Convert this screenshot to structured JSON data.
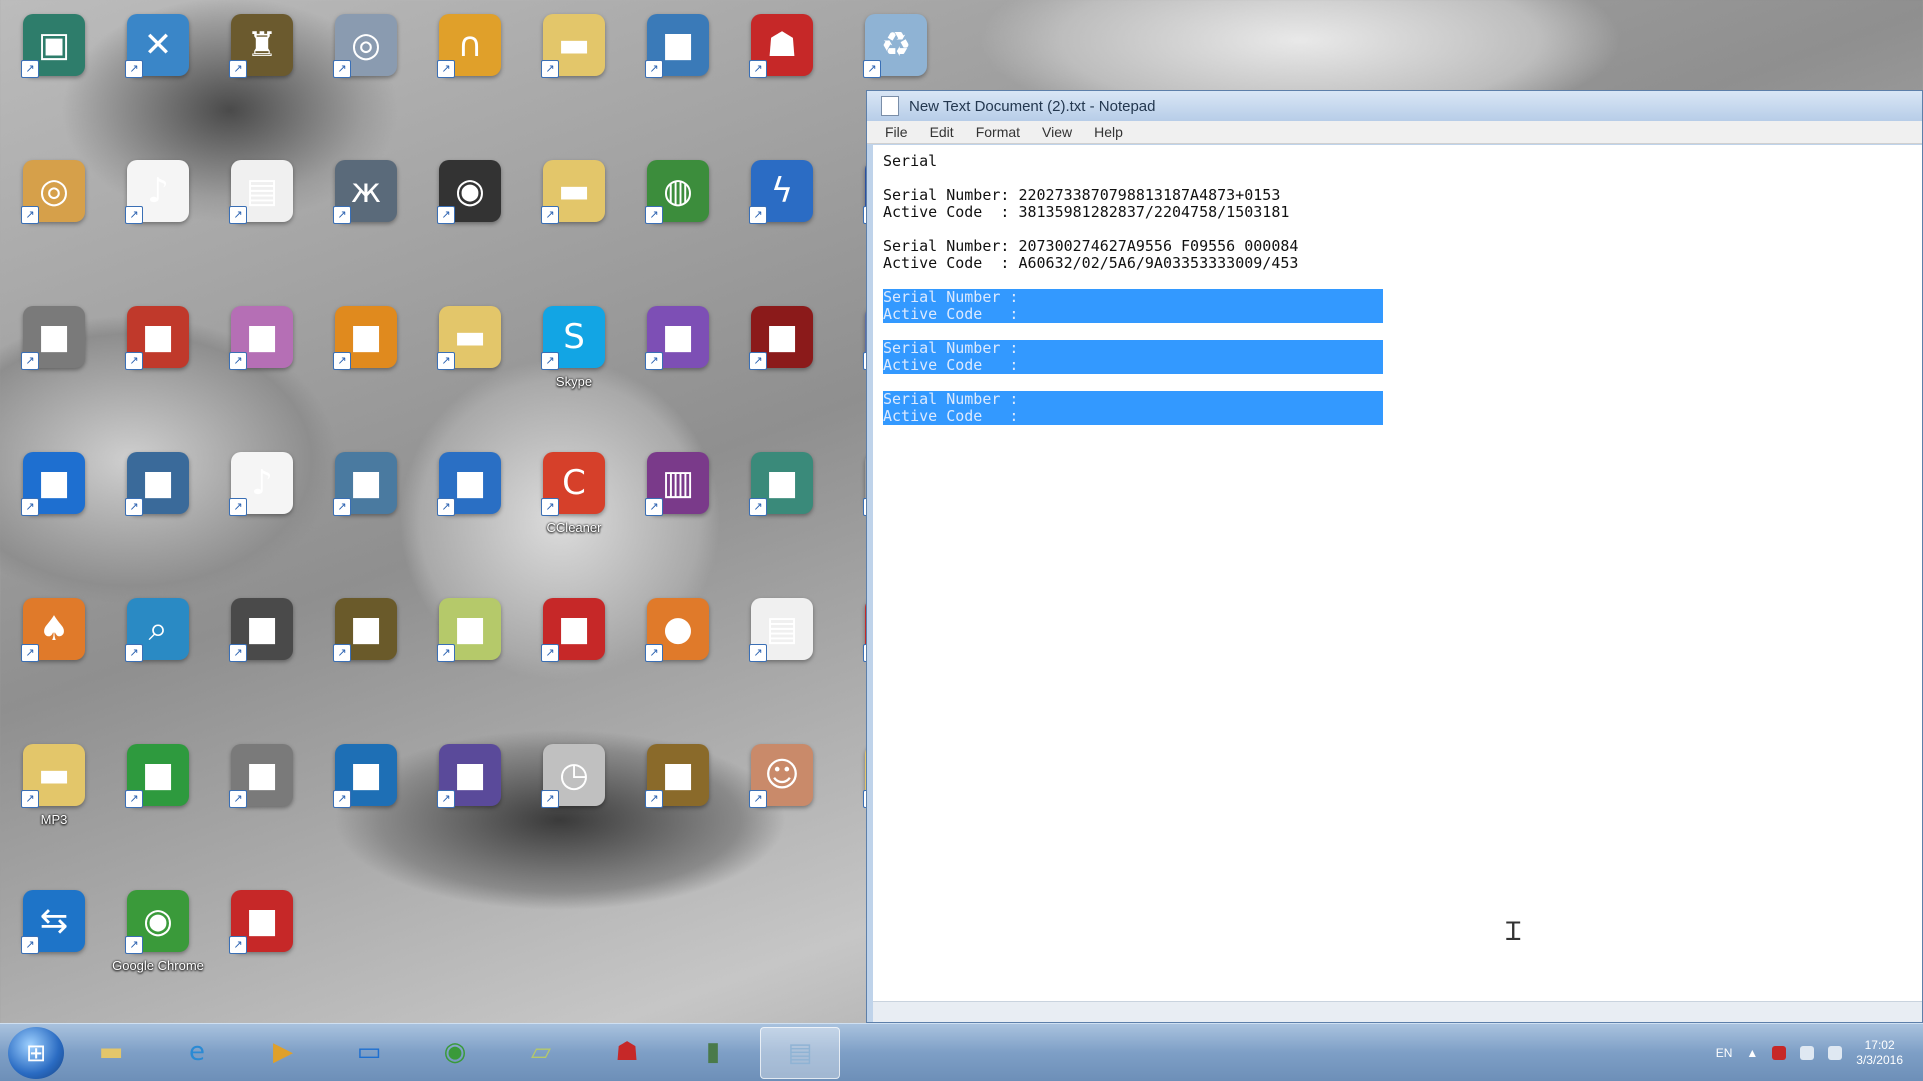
{
  "desktop": {
    "icons": [
      {
        "label": "",
        "icon": "picture-icon",
        "color": "#2e7d6b"
      },
      {
        "label": "",
        "icon": "tools-icon",
        "color": "#3a86c8"
      },
      {
        "label": "",
        "icon": "game-icon",
        "color": "#6b5a2e"
      },
      {
        "label": "",
        "icon": "disc-icon",
        "color": "#8a9bb0"
      },
      {
        "label": "",
        "icon": "headphones-icon",
        "color": "#e0a02a"
      },
      {
        "label": "",
        "icon": "folder-icon",
        "color": "#e3c66a"
      },
      {
        "label": "",
        "icon": "app-icon",
        "color": "#3a7ab8"
      },
      {
        "label": "",
        "icon": "robot-icon",
        "color": "#c62828"
      },
      {
        "label": "",
        "icon": "recycle-bin-icon",
        "color": "#8fb3d4"
      },
      {
        "label": "",
        "icon": "cd-icon",
        "color": "#d6a04a"
      },
      {
        "label": "",
        "icon": "music-file-icon",
        "color": "#f5f5f5"
      },
      {
        "label": "",
        "icon": "document-icon",
        "color": "#f0f0f0"
      },
      {
        "label": "",
        "icon": "butterfly-icon",
        "color": "#5a6a7a"
      },
      {
        "label": "",
        "icon": "audio-icon",
        "color": "#333333"
      },
      {
        "label": "",
        "icon": "folder-icon",
        "color": "#e3c66a"
      },
      {
        "label": "",
        "icon": "globe-icon",
        "color": "#3c8d3c"
      },
      {
        "label": "",
        "icon": "lightning-icon",
        "color": "#2b6cc4"
      },
      {
        "label": "",
        "icon": "app-icon",
        "color": "#2a4fa0"
      },
      {
        "label": "",
        "icon": "app-icon",
        "color": "#7a7a7a"
      },
      {
        "label": "",
        "icon": "app-icon",
        "color": "#c0392b"
      },
      {
        "label": "",
        "icon": "app-icon",
        "color": "#b56fb5"
      },
      {
        "label": "",
        "icon": "app-icon",
        "color": "#e08a1e"
      },
      {
        "label": "",
        "icon": "folder-icon",
        "color": "#e3c66a"
      },
      {
        "label": "Skype",
        "icon": "skype-icon",
        "color": "#12a5e4"
      },
      {
        "label": "",
        "icon": "app-icon",
        "color": "#7d4fb5"
      },
      {
        "label": "",
        "icon": "app-icon",
        "color": "#8b1a1a"
      },
      {
        "label": "",
        "icon": "app-icon",
        "color": "#5d6ea8"
      },
      {
        "label": "",
        "icon": "app-icon",
        "color": "#1e6fd0"
      },
      {
        "label": "",
        "icon": "app-icon",
        "color": "#3a6a9a"
      },
      {
        "label": "",
        "icon": "music-file-icon",
        "color": "#f5f5f5"
      },
      {
        "label": "",
        "icon": "app-icon",
        "color": "#4a7aa0"
      },
      {
        "label": "",
        "icon": "app-icon",
        "color": "#2a6fc4"
      },
      {
        "label": "CCleaner",
        "icon": "ccleaner-icon",
        "color": "#d6402a"
      },
      {
        "label": "",
        "icon": "archive-icon",
        "color": "#7a3a8a"
      },
      {
        "label": "",
        "icon": "app-icon",
        "color": "#3a8a7a"
      },
      {
        "label": "",
        "icon": "app-icon",
        "color": "#9a9a9a"
      },
      {
        "label": "",
        "icon": "mushroom-icon",
        "color": "#e07a2a"
      },
      {
        "label": "",
        "icon": "search-icon",
        "color": "#2a8ac4"
      },
      {
        "label": "",
        "icon": "app-icon",
        "color": "#4a4a4a"
      },
      {
        "label": "",
        "icon": "app-icon",
        "color": "#6a5a2a"
      },
      {
        "label": "",
        "icon": "app-icon",
        "color": "#b5c96a"
      },
      {
        "label": "",
        "icon": "app-icon",
        "color": "#c62828"
      },
      {
        "label": "",
        "icon": "basketball-icon",
        "color": "#e07a2a"
      },
      {
        "label": "",
        "icon": "document-icon",
        "color": "#f0f0f0"
      },
      {
        "label": "",
        "icon": "app-icon",
        "color": "#c62828"
      },
      {
        "label": "MP3",
        "icon": "folder-icon",
        "color": "#e3c66a"
      },
      {
        "label": "",
        "icon": "app-icon",
        "color": "#2e9a3e"
      },
      {
        "label": "",
        "icon": "app-icon",
        "color": "#7a7a7a"
      },
      {
        "label": "",
        "icon": "app-icon",
        "color": "#1e6fb5"
      },
      {
        "label": "",
        "icon": "app-icon",
        "color": "#5a4a9a"
      },
      {
        "label": "",
        "icon": "clock-icon",
        "color": "#c0c0c0"
      },
      {
        "label": "",
        "icon": "app-icon",
        "color": "#8a6a2a"
      },
      {
        "label": "",
        "icon": "avatar-icon",
        "color": "#c98a6a"
      },
      {
        "label": "",
        "icon": "folder-icon",
        "color": "#e3c66a"
      },
      {
        "label": "",
        "icon": "teamviewer-icon",
        "color": "#1e74c8"
      },
      {
        "label": "Google Chrome",
        "icon": "chrome-icon",
        "color": "#3a9a3a"
      },
      {
        "label": "",
        "icon": "app-icon",
        "color": "#c62828"
      }
    ]
  },
  "notepad": {
    "title": "New Text Document (2).txt - Notepad",
    "menu": [
      "File",
      "Edit",
      "Format",
      "View",
      "Help"
    ],
    "lines": [
      {
        "text": "Serial",
        "sel": false
      },
      {
        "text": "",
        "sel": false
      },
      {
        "text": "Serial Number: 2202733870798813187A4873+0153",
        "sel": false
      },
      {
        "text": "Active Code  : 38135981282837/2204758/1503181",
        "sel": false
      },
      {
        "text": "",
        "sel": false
      },
      {
        "text": "Serial Number: 207300274627A9556 F09556 000084",
        "sel": false
      },
      {
        "text": "Active Code  : A60632/02/5A6/9A03353333009/453",
        "sel": false
      },
      {
        "text": "",
        "sel": false
      },
      {
        "text": "Serial Number : ",
        "sel": true
      },
      {
        "text": "Active Code   : ",
        "sel": true
      },
      {
        "text": "",
        "sel": false
      },
      {
        "text": "Serial Number : ",
        "sel": true
      },
      {
        "text": "Active Code   : ",
        "sel": true
      },
      {
        "text": "",
        "sel": false
      },
      {
        "text": "Serial Number : ",
        "sel": true
      },
      {
        "text": "Active Code   : ",
        "sel": true
      }
    ]
  },
  "taskbar": {
    "items": [
      {
        "icon": "explorer-folder-icon",
        "color": "#e3c66a"
      },
      {
        "icon": "internet-explorer-icon",
        "color": "#2a8ad4"
      },
      {
        "icon": "media-player-icon",
        "color": "#e0a02a"
      },
      {
        "icon": "remote-desktop-icon",
        "color": "#1e6fd0"
      },
      {
        "icon": "chrome-icon",
        "color": "#3a9a3a"
      },
      {
        "icon": "notes-icon",
        "color": "#b5c96a"
      },
      {
        "icon": "robot-icon",
        "color": "#c62828"
      },
      {
        "icon": "app-icon",
        "color": "#4a7a4a"
      },
      {
        "icon": "notepad-icon",
        "color": "#8fb3d4"
      }
    ],
    "tray": {
      "lang": "EN",
      "time": "17:02",
      "date": "3/3/2016"
    }
  }
}
